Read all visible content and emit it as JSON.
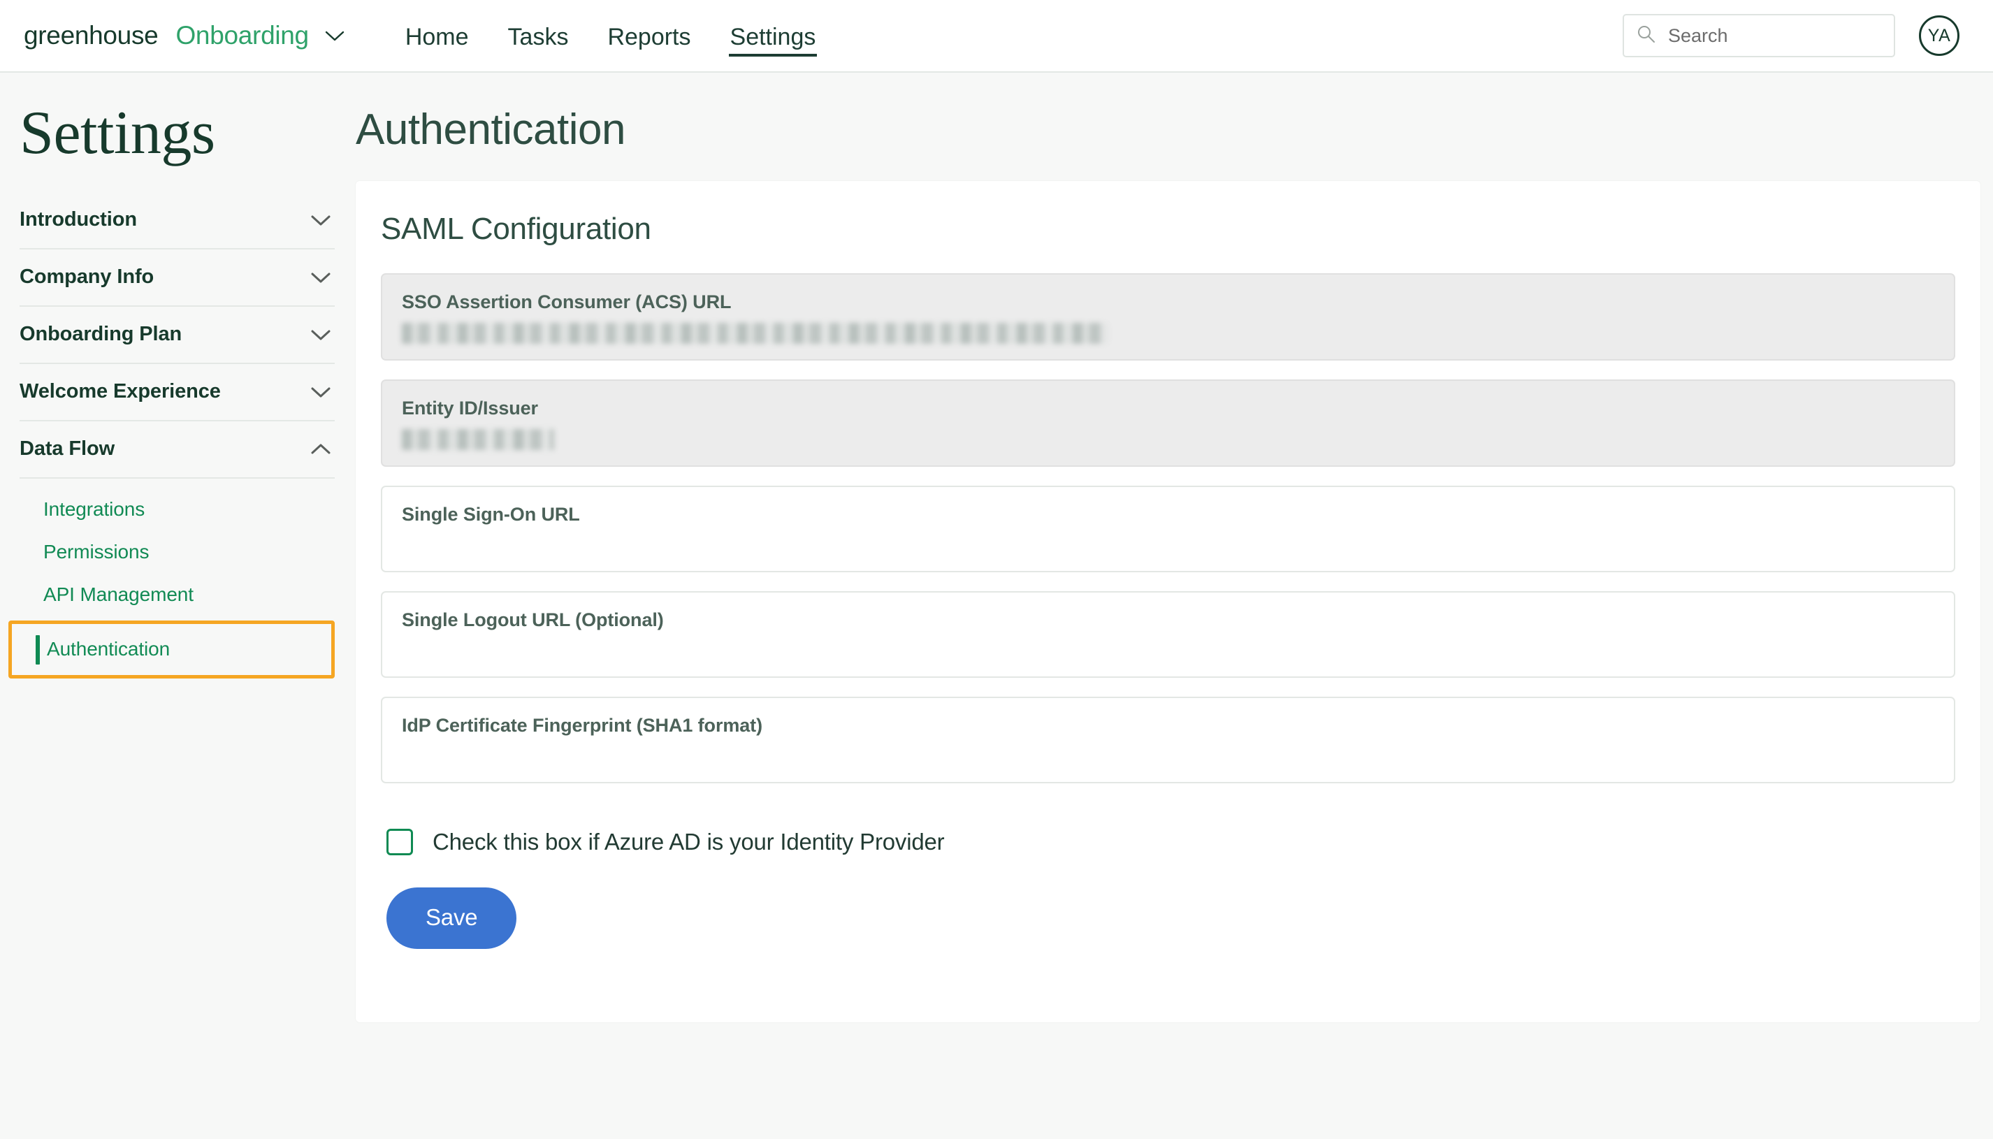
{
  "header": {
    "brand": {
      "primary": "greenhouse",
      "accent": "Onboarding",
      "chevron_icon": "chevron-down-icon"
    },
    "nav": [
      {
        "label": "Home",
        "active": false
      },
      {
        "label": "Tasks",
        "active": false
      },
      {
        "label": "Reports",
        "active": false
      },
      {
        "label": "Settings",
        "active": true
      }
    ],
    "search": {
      "placeholder": "Search",
      "value": "",
      "icon": "search-icon"
    },
    "avatar": {
      "initials": "YA"
    }
  },
  "sidebar": {
    "title": "Settings",
    "sections": [
      {
        "label": "Introduction",
        "expanded": false,
        "icon": "chevron-down-icon"
      },
      {
        "label": "Company Info",
        "expanded": false,
        "icon": "chevron-down-icon"
      },
      {
        "label": "Onboarding Plan",
        "expanded": false,
        "icon": "chevron-down-icon"
      },
      {
        "label": "Welcome Experience",
        "expanded": false,
        "icon": "chevron-down-icon"
      },
      {
        "label": "Data Flow",
        "expanded": true,
        "icon": "chevron-up-icon"
      }
    ],
    "data_flow_items": [
      {
        "label": "Integrations",
        "active": false
      },
      {
        "label": "Permissions",
        "active": false
      },
      {
        "label": "API Management",
        "active": false
      },
      {
        "label": "Authentication",
        "active": true,
        "annotated": true
      }
    ]
  },
  "main": {
    "page_heading": "Authentication",
    "card_title": "SAML Configuration",
    "fields": [
      {
        "label": "SSO Assertion Consumer (ACS) URL",
        "readonly": true,
        "value_redacted": true,
        "value": ""
      },
      {
        "label": "Entity ID/Issuer",
        "readonly": true,
        "value_redacted": true,
        "value": ""
      },
      {
        "label": "Single Sign-On URL",
        "readonly": false,
        "value_redacted": false,
        "value": ""
      },
      {
        "label": "Single Logout URL (Optional)",
        "readonly": false,
        "value_redacted": false,
        "value": ""
      },
      {
        "label": "IdP Certificate Fingerprint (SHA1 format)",
        "readonly": false,
        "value_redacted": false,
        "value": ""
      }
    ],
    "checkbox": {
      "label": "Check this box if Azure AD is your Identity Provider",
      "checked": false
    },
    "save_label": "Save"
  },
  "colors": {
    "brand_dark_green": "#173a2c",
    "brand_green": "#2fa26a",
    "link_green": "#118a54",
    "heading_green": "#2e4d42",
    "label_slate": "#4c6259",
    "save_blue": "#3b74d1",
    "annotation_orange": "#f5a623",
    "page_background": "#f7f8f7",
    "card_background": "#ffffff",
    "readonly_field_background": "#ececec"
  }
}
